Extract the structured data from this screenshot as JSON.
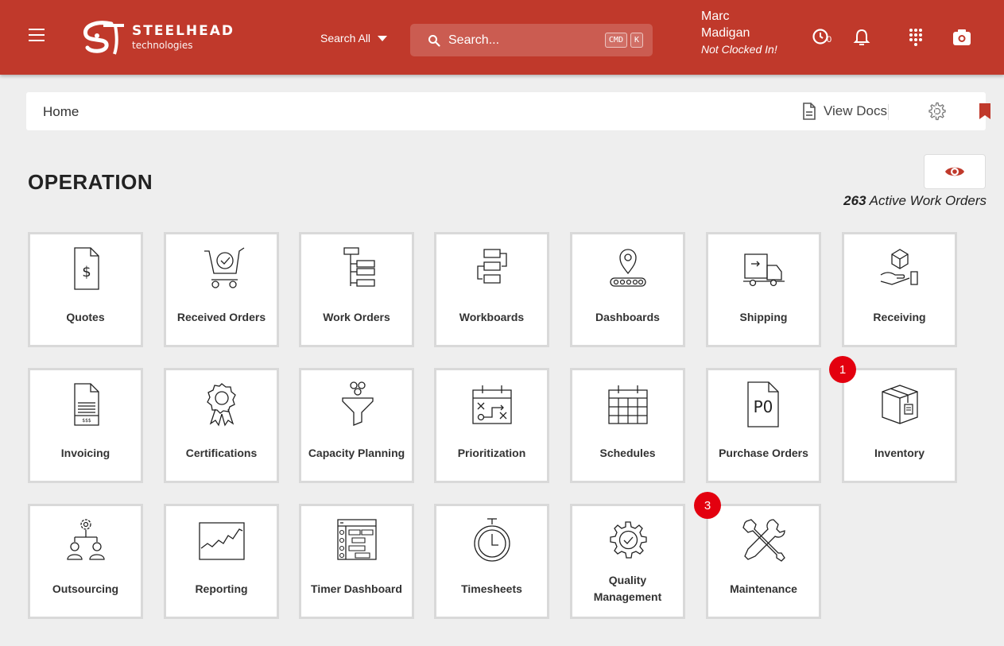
{
  "header": {
    "brand_name": "STEELHEAD",
    "brand_sub": "technologies",
    "search_scope": "Search All",
    "search_placeholder": "Search...",
    "shortcut_keys": [
      "CMD",
      "K"
    ],
    "user_first": "Marc",
    "user_last": "Madigan",
    "clock_status": "Not Clocked In!",
    "icons": [
      "menu-icon",
      "clock-icon",
      "bell-icon",
      "apps-grid-icon",
      "camera-icon"
    ],
    "clock_count": "0"
  },
  "breadcrumb": {
    "home": "Home",
    "view_docs": "View Docs"
  },
  "section": {
    "title": "OPERATION",
    "active_count": "263",
    "active_label": "Active Work Orders"
  },
  "colors": {
    "brand": "#c0392b",
    "badge": "#e3000f",
    "tile_border": "#d9d9d9"
  },
  "tiles": [
    {
      "label": "Quotes",
      "icon": "quote-document-icon"
    },
    {
      "label": "Received Orders",
      "icon": "cart-check-icon"
    },
    {
      "label": "Work Orders",
      "icon": "hierarchy-icon"
    },
    {
      "label": "Workboards",
      "icon": "workflow-icon"
    },
    {
      "label": "Dashboards",
      "icon": "location-conveyor-icon"
    },
    {
      "label": "Shipping",
      "icon": "truck-icon"
    },
    {
      "label": "Receiving",
      "icon": "hand-box-icon"
    },
    {
      "label": "Invoicing",
      "icon": "invoice-icon"
    },
    {
      "label": "Certifications",
      "icon": "award-ribbon-icon"
    },
    {
      "label": "Capacity Planning",
      "icon": "funnel-icon"
    },
    {
      "label": "Prioritization",
      "icon": "calendar-strategy-icon"
    },
    {
      "label": "Schedules",
      "icon": "calendar-icon"
    },
    {
      "label": "Purchase Orders",
      "icon": "po-document-icon"
    },
    {
      "label": "Inventory",
      "icon": "package-icon",
      "badge": "1"
    },
    {
      "label": "Outsourcing",
      "icon": "org-gear-icon"
    },
    {
      "label": "Reporting",
      "icon": "line-chart-icon"
    },
    {
      "label": "Timer Dashboard",
      "icon": "timer-dashboard-icon"
    },
    {
      "label": "Timesheets",
      "icon": "stopwatch-icon"
    },
    {
      "label": "Quality Management",
      "icon": "gear-check-icon"
    },
    {
      "label": "Maintenance",
      "icon": "tools-icon",
      "badge": "3"
    }
  ]
}
